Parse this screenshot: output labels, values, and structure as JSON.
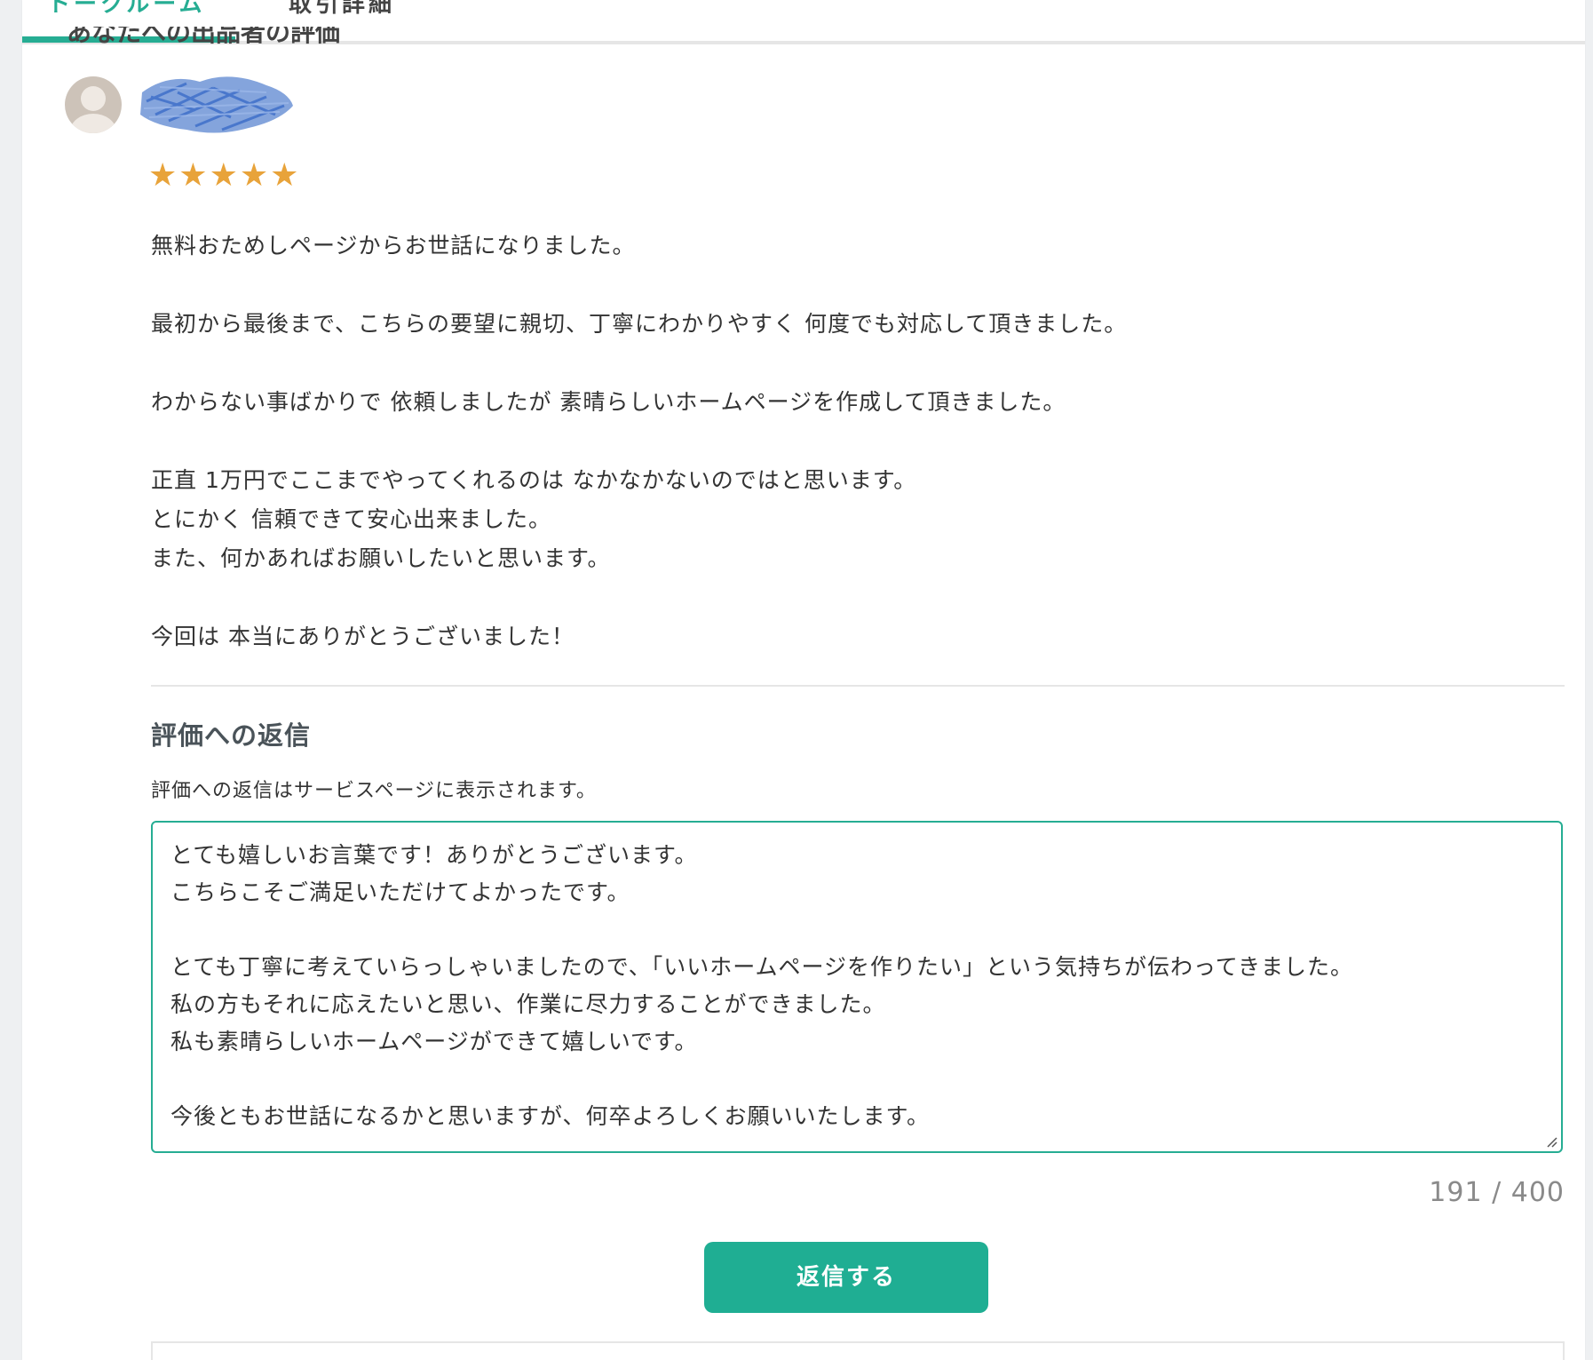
{
  "tabs": {
    "active_label": "トークルーム",
    "detail_label": "取引詳細"
  },
  "section": {
    "clipped_heading": "あなたへの出品者の評価"
  },
  "review": {
    "rating": 5,
    "star_glyph": "★",
    "lines": [
      "無料おためしページからお世話になりました。",
      "",
      "最初から最後まで、こちらの要望に親切、丁寧にわかりやすく 何度でも対応して頂きました。",
      "",
      "わからない事ばかりで 依頼しましたが 素晴らしいホームページを作成して頂きました。",
      "",
      "正直 1万円でここまでやってくれるのは なかなかないのではと思います。",
      "とにかく 信頼できて安心出来ました。",
      "また、何かあればお願いしたいと思います。",
      "",
      "今回は 本当にありがとうございました！"
    ]
  },
  "reply": {
    "heading": "評価への返信",
    "note": "評価への返信はサービスページに表示されます。",
    "lines": [
      "とても嬉しいお言葉です！ありがとうございます。",
      "こちらこそご満足いただけてよかったです。",
      "",
      "とても丁寧に考えていらっしゃいましたので、「いいホームページを作りたい」という気持ちが伝わってきました。",
      "私の方もそれに応えたいと思い、作業に尽力することができました。",
      "私も素晴らしいホームページができて嬉しいです。",
      "",
      "今後ともお世話になるかと思いますが、何卒よろしくお願いいたします。"
    ],
    "char_count": "191 / 400",
    "submit_label": "返信する"
  },
  "colors": {
    "accent": "#26ad93",
    "button": "#1fae93",
    "star": "#e8a33a"
  }
}
